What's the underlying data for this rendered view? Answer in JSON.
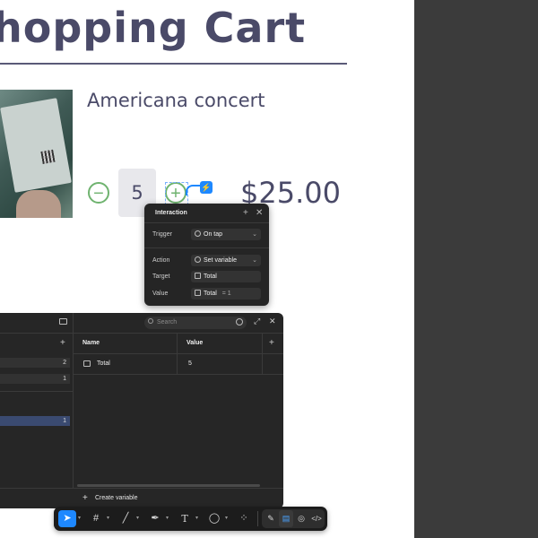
{
  "cart": {
    "title": "hopping Cart",
    "product_name": "Americana concert",
    "quantity": "5",
    "price": "$25.00",
    "minus_glyph": "−",
    "plus_glyph": "+"
  },
  "interaction_panel": {
    "title": "Interaction",
    "trigger_label": "Trigger",
    "trigger_value": "On tap",
    "action_label": "Action",
    "action_value": "Set variable",
    "target_label": "Target",
    "target_value": "Total",
    "value_label": "Value",
    "value_variable": "Total",
    "value_expression": "= 1"
  },
  "variables_panel": {
    "search_placeholder": "Search",
    "col_name": "Name",
    "col_value": "Value",
    "rows": [
      {
        "name": "Total",
        "value": "5"
      }
    ],
    "left_counts": [
      "2",
      "1",
      "1"
    ],
    "create_variable_label": "Create variable"
  },
  "toolbar": {
    "tools": [
      "move-tool",
      "frame-tool",
      "line-tool",
      "pen-tool",
      "text-tool",
      "comment-tool",
      "components-tool"
    ],
    "modes": [
      "design-mode",
      "prototype-mode",
      "dev-mode",
      "code-mode"
    ]
  },
  "colors": {
    "accent": "#1e88ff",
    "stepper_green": "#6fb36f",
    "heading": "#4a4a68",
    "panel_bg": "#262626"
  }
}
